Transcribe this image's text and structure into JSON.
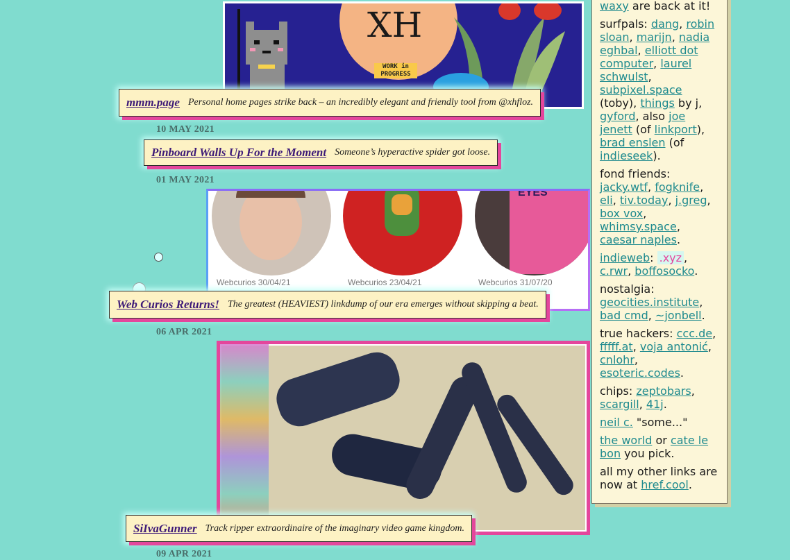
{
  "posts": [
    {
      "title": "mmm.page",
      "description": "Personal home pages strike back – an incredibly elegant and friendly tool from @xhfloz.",
      "image_text": "XH",
      "image_badge": "WORK in PROGRESS"
    },
    {
      "date": "10 MAY 2021",
      "title": "Pinboard Walls Up For the Moment",
      "description": "Someone’s hyperactive spider got loose."
    },
    {
      "date": "01 MAY 2021",
      "title": "Web Curios Returns!",
      "description": "The greatest (HEAVIEST) linkdump of our era emerges without skipping a beat.",
      "captions": [
        "Webcurios 30/04/21",
        "Webcurios 23/04/21",
        "Webcurios 31/07/20"
      ],
      "eyes_text": "EYES"
    },
    {
      "date": "06 APR 2021",
      "title": "SiIvaGunner",
      "description": "Track ripper extraordinaire of the imaginary video game kingdom."
    },
    {
      "date": "09 APR 2021"
    }
  ],
  "sidebar": {
    "waxy": "waxy",
    "waxy_suffix": " are back at it!",
    "surfpals_label": "surfpals: ",
    "surfpals": {
      "dang": "dang",
      "robin_sloan": "robin sloan",
      "marijn": "marijn",
      "nadia": "nadia eghbal",
      "elliott": "elliott dot computer",
      "laurel": "laurel schwulst",
      "subpixel": "subpixel.space",
      "toby": " (toby), ",
      "things": "things",
      "by_j": " by j, ",
      "gyford": "gyford",
      "also": ", also ",
      "joe": "joe jenett",
      "of1": " (of ",
      "linkport": "linkport",
      "close1": "), ",
      "brad": "brad enslen",
      "of2": " (of ",
      "indieseek": "indieseek",
      "close2": ")."
    },
    "fond_label": "fond friends: ",
    "fond": [
      "jacky.wtf",
      "fogknife",
      "eli",
      "tiv.today",
      "j.greg",
      "box vox",
      "whimsy.space",
      "caesar naples"
    ],
    "indieweb": "indieweb",
    "indieweb_colon": ": ",
    "xyz": ".xyz",
    "crwr": "c.rwr",
    "boffosocko": "boffosocko",
    "nostalgia_label": "nostalgia: ",
    "nostalgia": [
      "geocities.institute",
      "bad cmd",
      "~jonbell"
    ],
    "hackers_label": "true hackers: ",
    "hackers": [
      "ccc.de",
      "fffff.at",
      "voja antonić",
      "cnlohr",
      "esoteric.codes"
    ],
    "chips_label": "chips: ",
    "chips": [
      "zeptobars",
      "scargill",
      "41j"
    ],
    "neil": "neil c.",
    "neil_quote": " \"some...\"",
    "the_world": "the world",
    "or": " or ",
    "cate": "cate le bon",
    "pick": " you pick.",
    "other_links": "all my other links are now at ",
    "hrefcool": "href.cool",
    "period": "."
  },
  "colors": {
    "background": "#80dccf",
    "card": "#fdf2c4",
    "shadow_pink": "#e4469c",
    "link_purple": "#3d1a78",
    "link_teal": "#1e8a8e"
  }
}
